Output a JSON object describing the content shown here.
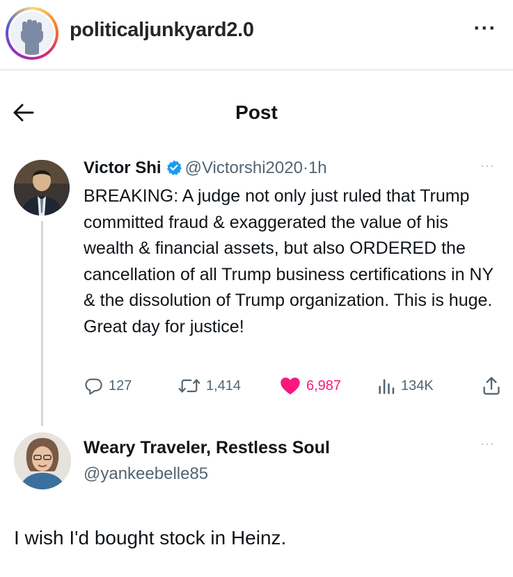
{
  "instagram": {
    "username": "politicaljunkyard2.0",
    "more_icon": "more-horizontal-icon",
    "more_label": "···"
  },
  "post": {
    "title": "Post",
    "back_icon": "arrow-left-icon"
  },
  "tweet": {
    "name": "Victor Shi",
    "verified": true,
    "handle": "@Victorshi2020",
    "separator": "·",
    "time": "1h",
    "body": "BREAKING: A judge not only just ruled that Trump committed fraud & exaggerated the value of his wealth & financial assets, but also ORDERED the cancellation of all Trump business certifications in NY & the dissolution of Trump organization. This is huge. Great day for justice!",
    "more_label": "···",
    "stats": {
      "replies": "127",
      "retweets": "1,414",
      "likes": "6,987",
      "views": "134K"
    },
    "liked": true
  },
  "reply": {
    "name": "Weary Traveler, Restless Soul",
    "handle": "@yankeebelle85",
    "more_label": "···",
    "body": "I wish I'd bought stock in Heinz."
  },
  "colors": {
    "like": "#f91880",
    "verified": "#1d9bf0",
    "secondary_text": "#536471"
  }
}
